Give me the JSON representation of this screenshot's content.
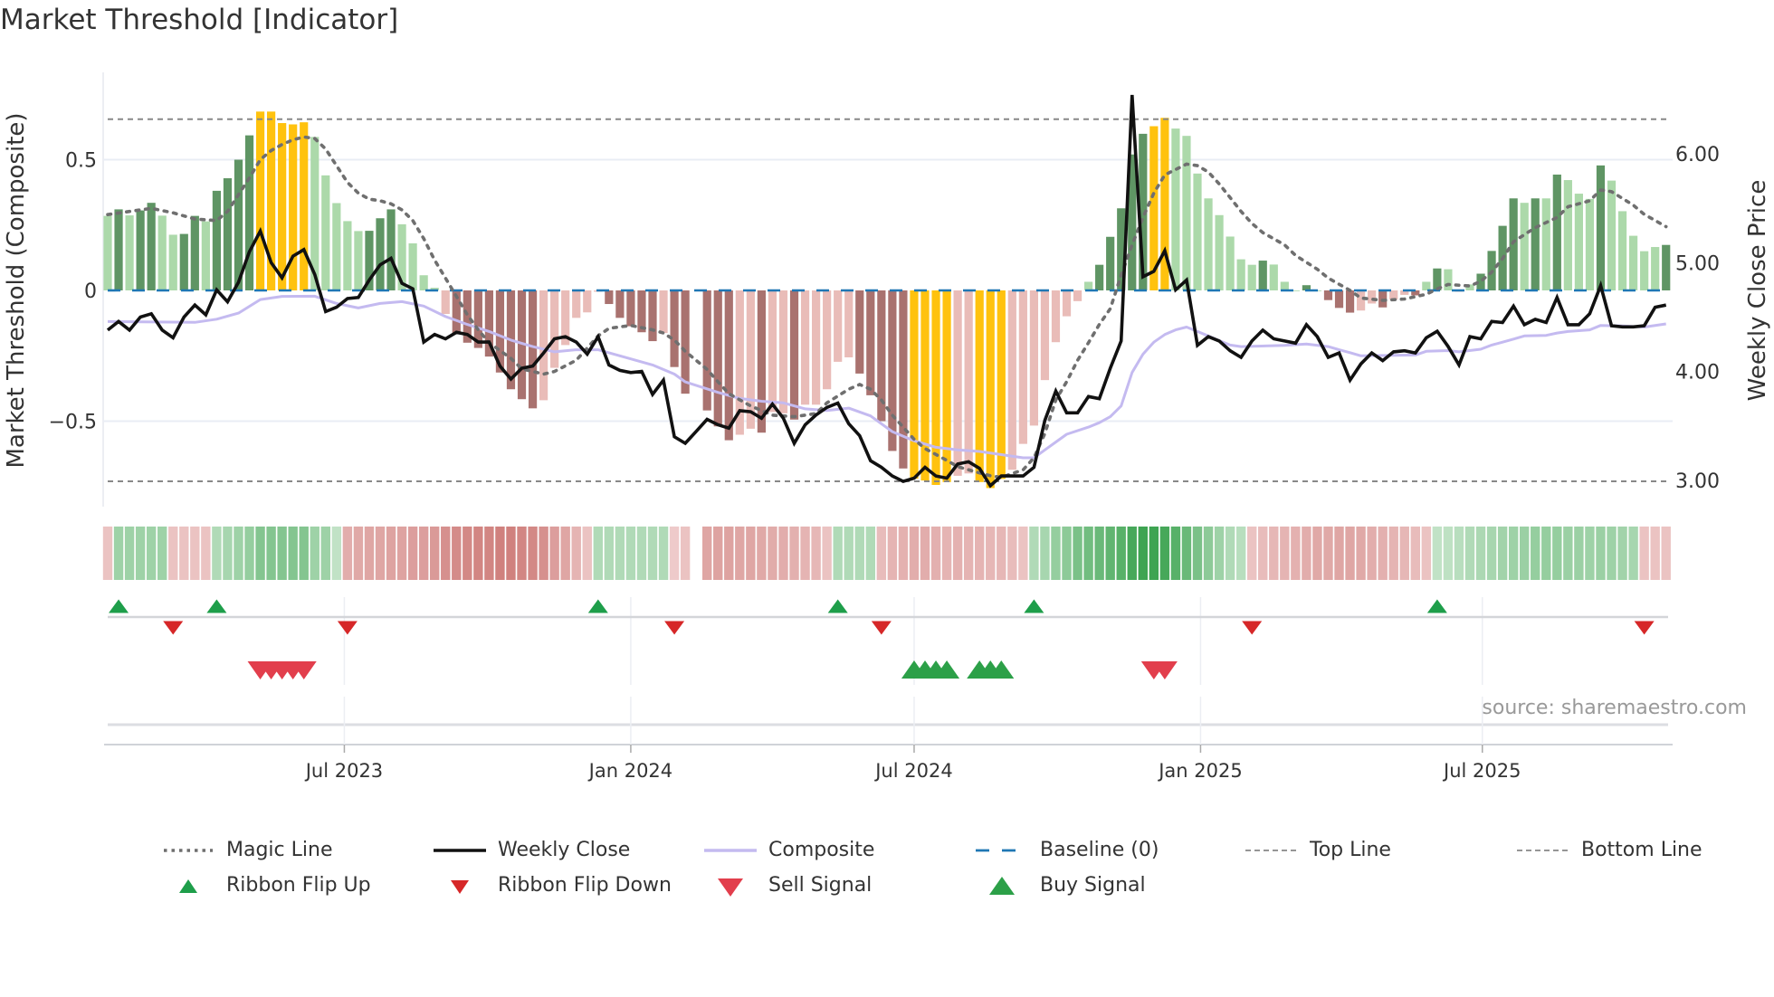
{
  "title": "Market Threshold [Indicator]",
  "source": "source: sharemaestro.com",
  "chart_data": {
    "type": "bar+line",
    "title": "Market Threshold [Indicator]",
    "ylabel_left": "Market Threshold (Composite)",
    "ylabel_right": "Weekly Close Price",
    "weeks_start": "2023-01-30",
    "interval": "weekly",
    "ylim_left": [
      -0.83,
      0.78
    ],
    "ylim_right": [
      2.2,
      6.9
    ],
    "left_ticks": [
      {
        "value": 0.5,
        "label": "0.5"
      },
      {
        "value": 0,
        "label": "0"
      },
      {
        "value": -0.5,
        "label": "−0.5"
      }
    ],
    "right_ticks": [
      {
        "value": 6,
        "label": "6.00"
      },
      {
        "value": 5,
        "label": "5.00"
      },
      {
        "value": 4,
        "label": "4.00"
      },
      {
        "value": 3,
        "label": "3.00"
      }
    ],
    "x_ticks": [
      {
        "date": "2023-07-01",
        "label": "Jul 2023"
      },
      {
        "date": "2024-01-01",
        "label": "Jan 2024"
      },
      {
        "date": "2024-07-01",
        "label": "Jul 2024"
      },
      {
        "date": "2025-01-01",
        "label": "Jan 2025"
      },
      {
        "date": "2025-07-01",
        "label": "Jul 2025"
      }
    ],
    "top_line": 0.655,
    "bottom_line": -0.73,
    "baseline": 0,
    "colors": {
      "D": "#5f9564",
      "L": "#acd9aa",
      "G": "#ffc20e",
      "R": "#a9726f",
      "P": "#e9bcb8",
      "close": "#111111",
      "composite": "#c4baf0",
      "magic": "#6f6f6f",
      "baseline": "#1f77b4",
      "level": "#888888",
      "flip_up": "#1e9e4a",
      "flip_down": "#d62728",
      "sell": "#e23e4c",
      "buy": "#2ca048"
    },
    "bar_classes_legend": {
      "D": "bullish rising",
      "L": "bullish fading",
      "G": "extreme",
      "R": "bearish rising",
      "P": "bearish fading"
    },
    "bars": [
      0.285,
      0.31,
      0.287,
      0.306,
      0.335,
      0.286,
      0.213,
      0.216,
      0.285,
      0.264,
      0.381,
      0.429,
      0.5,
      0.593,
      0.684,
      0.684,
      0.64,
      0.635,
      0.643,
      0.587,
      0.44,
      0.334,
      0.265,
      0.227,
      0.228,
      0.276,
      0.31,
      0.253,
      0.18,
      0.058,
      0.01,
      -0.09,
      -0.163,
      -0.2,
      -0.22,
      -0.253,
      -0.314,
      -0.378,
      -0.416,
      -0.451,
      -0.42,
      -0.296,
      -0.209,
      -0.105,
      -0.084,
      -0.005,
      -0.052,
      -0.105,
      -0.137,
      -0.16,
      -0.194,
      -0.163,
      -0.293,
      -0.395,
      null,
      -0.459,
      -0.52,
      -0.573,
      -0.552,
      -0.529,
      -0.544,
      -0.465,
      -0.47,
      -0.494,
      -0.437,
      -0.437,
      -0.378,
      -0.273,
      -0.256,
      -0.318,
      -0.401,
      -0.5,
      -0.614,
      -0.681,
      -0.72,
      -0.727,
      -0.744,
      -0.733,
      -0.709,
      -0.7,
      -0.733,
      -0.756,
      -0.721,
      -0.686,
      -0.587,
      -0.517,
      -0.343,
      -0.198,
      -0.099,
      -0.041,
      0.033,
      0.098,
      0.205,
      0.314,
      0.52,
      0.599,
      0.628,
      0.66,
      0.619,
      0.591,
      0.447,
      0.352,
      0.288,
      0.206,
      0.119,
      0.098,
      0.114,
      0.099,
      0.033,
      0,
      0.02,
      0,
      -0.037,
      -0.067,
      -0.085,
      -0.077,
      -0.05,
      -0.065,
      -0.035,
      -0.017,
      -0.019,
      0.033,
      0.084,
      0.081,
      -0.005,
      0.023,
      0.064,
      0.151,
      0.247,
      0.352,
      0.335,
      0.352,
      0.352,
      0.443,
      0.422,
      0.37,
      0.35,
      0.478,
      0.42,
      0.303,
      0.209,
      0.15,
      0.166,
      0.174
    ],
    "bar_classes": "LDLDDLLDDLDDDDGGGGGLLLLLDDDLLLLPRRRRRRRRPPPPPPRRRRRPRR_RRRPPRPPRPPPPPRRRRRGGGGPPGGGPPPPPPPLDDDDDGGLLLLLLLLDLLLDLRRRPPRPPRLDLPLDDDDLDLDLLLDLLLLLDD",
    "weekly_close": [
      4.38,
      4.46,
      4.38,
      4.5,
      4.53,
      4.38,
      4.31,
      4.5,
      4.61,
      4.52,
      4.75,
      4.64,
      4.82,
      5.1,
      5.29,
      5.0,
      4.86,
      5.06,
      5.12,
      4.89,
      4.55,
      4.59,
      4.67,
      4.68,
      4.84,
      4.98,
      5.04,
      4.81,
      4.76,
      4.27,
      4.34,
      4.3,
      4.36,
      4.34,
      4.27,
      4.27,
      4.05,
      3.93,
      4.03,
      4.05,
      4.17,
      4.3,
      4.32,
      4.27,
      4.16,
      4.32,
      4.06,
      4.01,
      3.99,
      4.0,
      3.79,
      3.92,
      3.4,
      3.34,
      3.45,
      3.56,
      3.51,
      3.48,
      3.64,
      3.63,
      3.57,
      3.7,
      3.57,
      3.34,
      3.51,
      3.6,
      3.67,
      3.71,
      3.52,
      3.41,
      3.18,
      3.12,
      3.04,
      2.99,
      3.02,
      3.12,
      3.04,
      3.02,
      3.15,
      3.17,
      3.11,
      2.95,
      3.04,
      3.04,
      3.04,
      3.12,
      3.55,
      3.82,
      3.62,
      3.62,
      3.77,
      3.75,
      4.03,
      4.28,
      6.54,
      4.87,
      4.92,
      5.11,
      4.75,
      4.84,
      4.24,
      4.32,
      4.28,
      4.19,
      4.13,
      4.28,
      4.38,
      4.3,
      4.28,
      4.26,
      4.43,
      4.32,
      4.13,
      4.17,
      3.92,
      4.07,
      4.17,
      4.1,
      4.18,
      4.19,
      4.17,
      4.31,
      4.37,
      4.23,
      4.06,
      4.32,
      4.3,
      4.46,
      4.45,
      4.6,
      4.43,
      4.48,
      4.45,
      4.68,
      4.43,
      4.43,
      4.53,
      4.79,
      4.42,
      4.41,
      4.41,
      4.42,
      4.59,
      4.61
    ],
    "composite": [
      [
        0,
        -0.119
      ],
      [
        8,
        -0.122
      ],
      [
        10,
        -0.11
      ],
      [
        12,
        -0.087
      ],
      [
        14,
        -0.035
      ],
      [
        16,
        -0.023
      ],
      [
        19,
        -0.022
      ],
      [
        21,
        -0.05
      ],
      [
        23,
        -0.067
      ],
      [
        25,
        -0.05
      ],
      [
        27,
        -0.043
      ],
      [
        29,
        -0.06
      ],
      [
        31,
        -0.1
      ],
      [
        33,
        -0.13
      ],
      [
        35,
        -0.157
      ],
      [
        37,
        -0.19
      ],
      [
        39,
        -0.215
      ],
      [
        41,
        -0.235
      ],
      [
        43,
        -0.227
      ],
      [
        45,
        -0.227
      ],
      [
        47,
        -0.25
      ],
      [
        50,
        -0.285
      ],
      [
        52,
        -0.32
      ],
      [
        53,
        -0.35
      ],
      [
        56,
        -0.39
      ],
      [
        58,
        -0.413
      ],
      [
        60,
        -0.424
      ],
      [
        62,
        -0.43
      ],
      [
        64,
        -0.453
      ],
      [
        66,
        -0.459
      ],
      [
        68,
        -0.45
      ],
      [
        70,
        -0.48
      ],
      [
        72,
        -0.54
      ],
      [
        74,
        -0.575
      ],
      [
        76,
        -0.6
      ],
      [
        78,
        -0.61
      ],
      [
        80,
        -0.616
      ],
      [
        82,
        -0.628
      ],
      [
        84,
        -0.64
      ],
      [
        85,
        -0.64
      ],
      [
        86,
        -0.61
      ],
      [
        87,
        -0.58
      ],
      [
        88,
        -0.55
      ],
      [
        90,
        -0.523
      ],
      [
        91,
        -0.506
      ],
      [
        92,
        -0.483
      ],
      [
        93,
        -0.442
      ],
      [
        94,
        -0.314
      ],
      [
        95,
        -0.244
      ],
      [
        96,
        -0.198
      ],
      [
        97,
        -0.169
      ],
      [
        98,
        -0.151
      ],
      [
        99,
        -0.14
      ],
      [
        100,
        -0.157
      ],
      [
        101,
        -0.174
      ],
      [
        102,
        -0.192
      ],
      [
        103,
        -0.209
      ],
      [
        104,
        -0.215
      ],
      [
        108,
        -0.21
      ],
      [
        110,
        -0.205
      ],
      [
        112,
        -0.215
      ],
      [
        113,
        -0.227
      ],
      [
        114,
        -0.238
      ],
      [
        115,
        -0.25
      ],
      [
        120,
        -0.247
      ],
      [
        121,
        -0.233
      ],
      [
        123,
        -0.23
      ],
      [
        124,
        -0.235
      ],
      [
        126,
        -0.225
      ],
      [
        127,
        -0.209
      ],
      [
        128,
        -0.198
      ],
      [
        129,
        -0.186
      ],
      [
        130,
        -0.174
      ],
      [
        132,
        -0.172
      ],
      [
        133,
        -0.163
      ],
      [
        134,
        -0.157
      ],
      [
        136,
        -0.151
      ],
      [
        137,
        -0.134
      ],
      [
        139,
        -0.136
      ],
      [
        141,
        -0.14
      ],
      [
        143,
        -0.128
      ]
    ],
    "magic_line": [
      [
        0,
        0.29
      ],
      [
        2,
        0.302
      ],
      [
        4,
        0.314
      ],
      [
        6,
        0.297
      ],
      [
        8,
        0.273
      ],
      [
        10,
        0.267
      ],
      [
        11,
        0.302
      ],
      [
        12,
        0.366
      ],
      [
        13,
        0.43
      ],
      [
        14,
        0.5
      ],
      [
        15,
        0.535
      ],
      [
        16,
        0.558
      ],
      [
        17,
        0.576
      ],
      [
        18,
        0.587
      ],
      [
        19,
        0.581
      ],
      [
        20,
        0.541
      ],
      [
        21,
        0.477
      ],
      [
        22,
        0.413
      ],
      [
        23,
        0.372
      ],
      [
        24,
        0.349
      ],
      [
        25,
        0.343
      ],
      [
        26,
        0.331
      ],
      [
        27,
        0.308
      ],
      [
        28,
        0.267
      ],
      [
        29,
        0.198
      ],
      [
        30,
        0.116
      ],
      [
        31,
        0.047
      ],
      [
        32,
        -0.023
      ],
      [
        33,
        -0.093
      ],
      [
        34,
        -0.151
      ],
      [
        35,
        -0.2
      ],
      [
        37,
        -0.26
      ],
      [
        38,
        -0.3
      ],
      [
        40,
        -0.32
      ],
      [
        41,
        -0.31
      ],
      [
        43,
        -0.267
      ],
      [
        45,
        -0.174
      ],
      [
        46,
        -0.145
      ],
      [
        48,
        -0.134
      ],
      [
        50,
        -0.151
      ],
      [
        51,
        -0.163
      ],
      [
        52,
        -0.19
      ],
      [
        53,
        -0.233
      ],
      [
        55,
        -0.302
      ],
      [
        56,
        -0.349
      ],
      [
        57,
        -0.395
      ],
      [
        59,
        -0.442
      ],
      [
        61,
        -0.477
      ],
      [
        63,
        -0.483
      ],
      [
        65,
        -0.471
      ],
      [
        66,
        -0.43
      ],
      [
        68,
        -0.378
      ],
      [
        69,
        -0.36
      ],
      [
        70,
        -0.378
      ],
      [
        71,
        -0.419
      ],
      [
        72,
        -0.477
      ],
      [
        73,
        -0.523
      ],
      [
        74,
        -0.57
      ],
      [
        75,
        -0.605
      ],
      [
        77,
        -0.65
      ],
      [
        78,
        -0.674
      ],
      [
        80,
        -0.698
      ],
      [
        81,
        -0.709
      ],
      [
        82,
        -0.715
      ],
      [
        84,
        -0.686
      ],
      [
        85,
        -0.64
      ],
      [
        86,
        -0.547
      ],
      [
        87,
        -0.419
      ],
      [
        88,
        -0.349
      ],
      [
        89,
        -0.267
      ],
      [
        90,
        -0.2
      ],
      [
        91,
        -0.13
      ],
      [
        92,
        -0.07
      ],
      [
        93,
        0.058
      ],
      [
        94,
        0.174
      ],
      [
        95,
        0.279
      ],
      [
        96,
        0.372
      ],
      [
        97,
        0.442
      ],
      [
        99,
        0.483
      ],
      [
        100,
        0.477
      ],
      [
        101,
        0.453
      ],
      [
        102,
        0.407
      ],
      [
        103,
        0.355
      ],
      [
        104,
        0.302
      ],
      [
        105,
        0.256
      ],
      [
        106,
        0.221
      ],
      [
        108,
        0.174
      ],
      [
        109,
        0.134
      ],
      [
        111,
        0.081
      ],
      [
        112,
        0.047
      ],
      [
        114,
        0
      ],
      [
        115,
        -0.029
      ],
      [
        117,
        -0.038
      ],
      [
        119,
        -0.033
      ],
      [
        121,
        -0.015
      ],
      [
        122,
        0.006
      ],
      [
        123,
        0.023
      ],
      [
        125,
        0.017
      ],
      [
        126,
        0.035
      ],
      [
        127,
        0.07
      ],
      [
        128,
        0.122
      ],
      [
        129,
        0.186
      ],
      [
        131,
        0.24
      ],
      [
        133,
        0.279
      ],
      [
        134,
        0.32
      ],
      [
        136,
        0.343
      ],
      [
        137,
        0.384
      ],
      [
        138,
        0.378
      ],
      [
        140,
        0.326
      ],
      [
        141,
        0.291
      ],
      [
        143,
        0.244
      ]
    ],
    "ribbon": [
      -0.2,
      0.4,
      0.4,
      0.4,
      0.4,
      0.4,
      -0.2,
      -0.2,
      -0.2,
      -0.2,
      0.3,
      0.35,
      0.4,
      0.45,
      0.55,
      0.55,
      0.55,
      0.55,
      0.55,
      0.4,
      0.4,
      0.2,
      -0.35,
      -0.38,
      -0.4,
      -0.4,
      -0.42,
      -0.42,
      -0.45,
      -0.45,
      -0.48,
      -0.55,
      -0.58,
      -0.6,
      -0.62,
      -0.62,
      -0.65,
      -0.65,
      -0.62,
      -0.6,
      -0.55,
      -0.45,
      -0.4,
      -0.3,
      -0.2,
      0.3,
      0.3,
      0.3,
      0.3,
      0.3,
      0.3,
      0.3,
      -0.15,
      -0.2,
      null,
      -0.4,
      -0.42,
      -0.42,
      -0.4,
      -0.4,
      -0.38,
      -0.36,
      -0.35,
      -0.33,
      -0.3,
      -0.28,
      -0.2,
      0.3,
      0.3,
      0.3,
      0.3,
      -0.25,
      -0.3,
      -0.32,
      -0.35,
      -0.35,
      -0.33,
      -0.3,
      -0.32,
      -0.3,
      -0.3,
      -0.28,
      -0.28,
      -0.25,
      -0.2,
      0.3,
      0.35,
      0.45,
      0.5,
      0.6,
      0.65,
      0.7,
      0.75,
      0.8,
      0.9,
      0.95,
      0.95,
      0.9,
      0.8,
      0.7,
      0.6,
      0.5,
      0.4,
      0.3,
      0.25,
      -0.2,
      -0.25,
      -0.28,
      -0.3,
      -0.32,
      -0.35,
      -0.38,
      -0.38,
      -0.4,
      -0.4,
      -0.38,
      -0.35,
      -0.33,
      -0.3,
      -0.28,
      -0.25,
      -0.2,
      0.2,
      0.22,
      0.25,
      0.3,
      0.32,
      0.35,
      0.38,
      0.4,
      0.42,
      0.45,
      0.45,
      0.45,
      0.42,
      0.42,
      0.4,
      0.42,
      0.4,
      0.38,
      0.35,
      -0.2,
      -0.2,
      -0.2
    ],
    "ribbon_flip_up": [
      1,
      10,
      45,
      67,
      85,
      122
    ],
    "ribbon_flip_down": [
      6,
      22,
      52,
      71,
      105,
      141
    ],
    "sell_signal": [
      14,
      15,
      16,
      17,
      18,
      96,
      97
    ],
    "buy_signal": [
      74,
      75,
      76,
      77,
      80,
      81,
      82
    ]
  },
  "legend": [
    {
      "label": "Magic Line",
      "kind": "magic"
    },
    {
      "label": "Weekly Close",
      "kind": "close"
    },
    {
      "label": "Composite",
      "kind": "composite"
    },
    {
      "label": "Baseline (0)",
      "kind": "baseline"
    },
    {
      "label": "Top Line",
      "kind": "level"
    },
    {
      "label": "Bottom Line",
      "kind": "level"
    },
    {
      "label": "Ribbon Flip Up",
      "kind": "flip_up"
    },
    {
      "label": "Ribbon Flip Down",
      "kind": "flip_down"
    },
    {
      "label": "Sell Signal",
      "kind": "sell"
    },
    {
      "label": "Buy Signal",
      "kind": "buy"
    }
  ]
}
